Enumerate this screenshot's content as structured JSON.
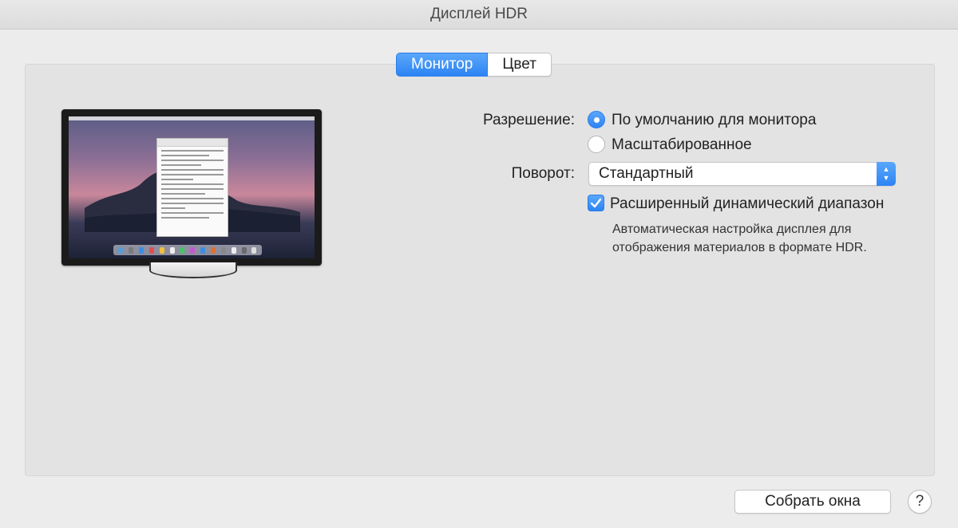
{
  "window": {
    "title": "Дисплей HDR"
  },
  "tabs": [
    {
      "label": "Монитор",
      "selected": true
    },
    {
      "label": "Цвет",
      "selected": false
    }
  ],
  "resolution": {
    "label": "Разрешение:",
    "options": [
      {
        "label": "По умолчанию для монитора",
        "selected": true
      },
      {
        "label": "Масштабированное",
        "selected": false
      }
    ]
  },
  "rotation": {
    "label": "Поворот:",
    "value": "Стандартный"
  },
  "hdr": {
    "label": "Расширенный динамический диапазон",
    "checked": true,
    "description_line1": "Автоматическая настройка дисплея для",
    "description_line2": "отображения материалов в формате HDR."
  },
  "footer": {
    "gather_windows_label": "Собрать окна",
    "help_label": "?"
  },
  "colors": {
    "accent": "#2d84f3",
    "window_bg": "#ececec",
    "panel_bg": "#e3e3e3"
  }
}
